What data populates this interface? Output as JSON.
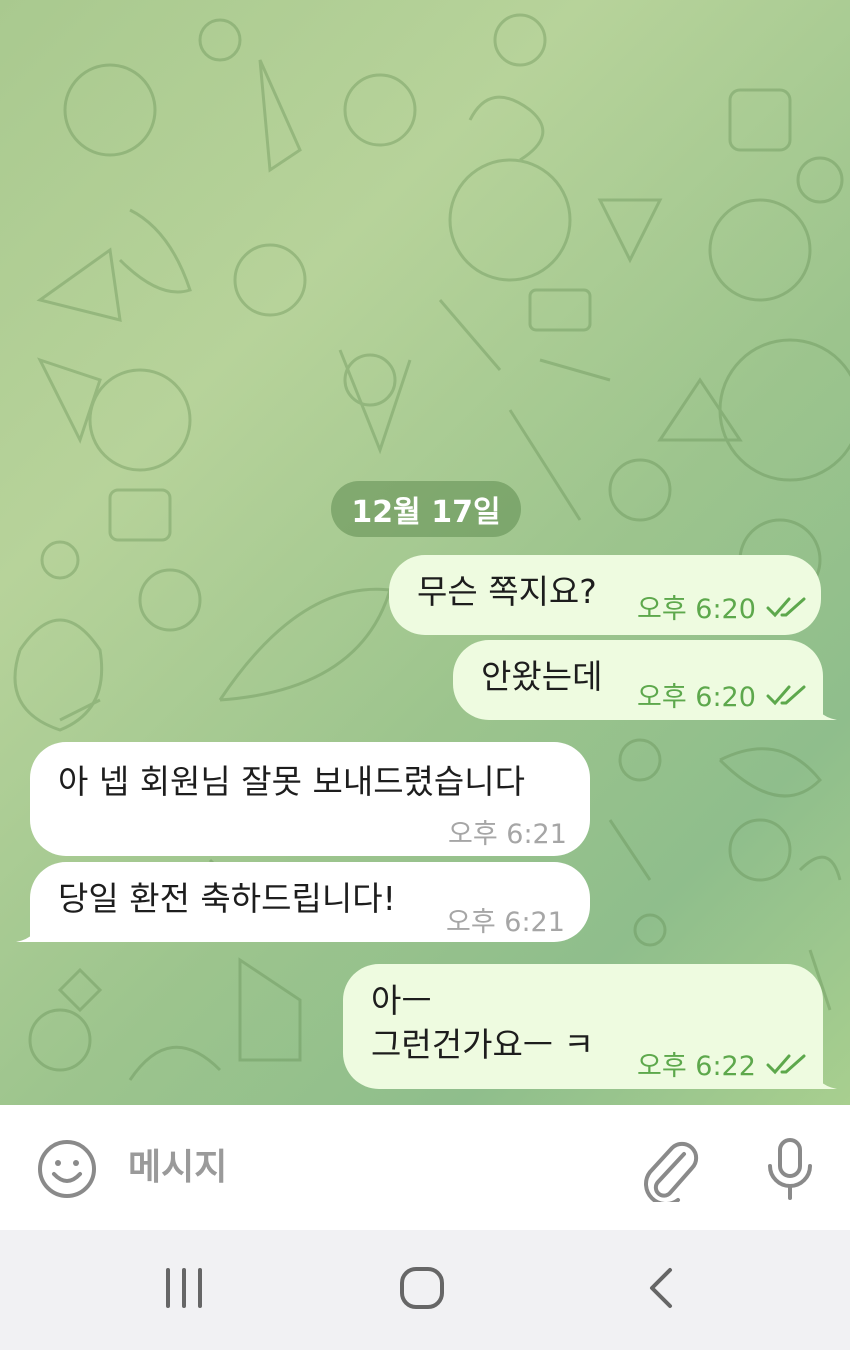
{
  "date_divider": "12월 17일",
  "messages": [
    {
      "direction": "out",
      "text": "무슨 쪽지요?",
      "time": "오후 6:20",
      "status_icon": "double-check-icon"
    },
    {
      "direction": "out",
      "text": "안왔는데",
      "time": "오후 6:20",
      "status_icon": "double-check-icon"
    },
    {
      "direction": "in",
      "text": "아 넵 회원님 잘못 보내드렸습니다",
      "time": "오후 6:21"
    },
    {
      "direction": "in",
      "text": "당일 환전 축하드립니다!",
      "time": "오후 6:21"
    },
    {
      "direction": "out",
      "text": "아ㅡ\n그런건가요ㅡ ㅋ",
      "time": "오후 6:22",
      "status_icon": "double-check-icon"
    }
  ],
  "composer": {
    "placeholder": "메시지",
    "emoji_icon": "smiley-icon",
    "attach_icon": "paperclip-icon",
    "mic_icon": "microphone-icon"
  },
  "navbar": {
    "recents_icon": "recents-icon",
    "home_icon": "home-icon",
    "back_icon": "back-icon"
  },
  "colors": {
    "outgoing_bubble": "#eefbe0",
    "incoming_bubble": "#ffffff",
    "outgoing_meta": "#5da84c",
    "incoming_meta": "#a6a6a6",
    "date_pill": "#6f9a5e"
  }
}
